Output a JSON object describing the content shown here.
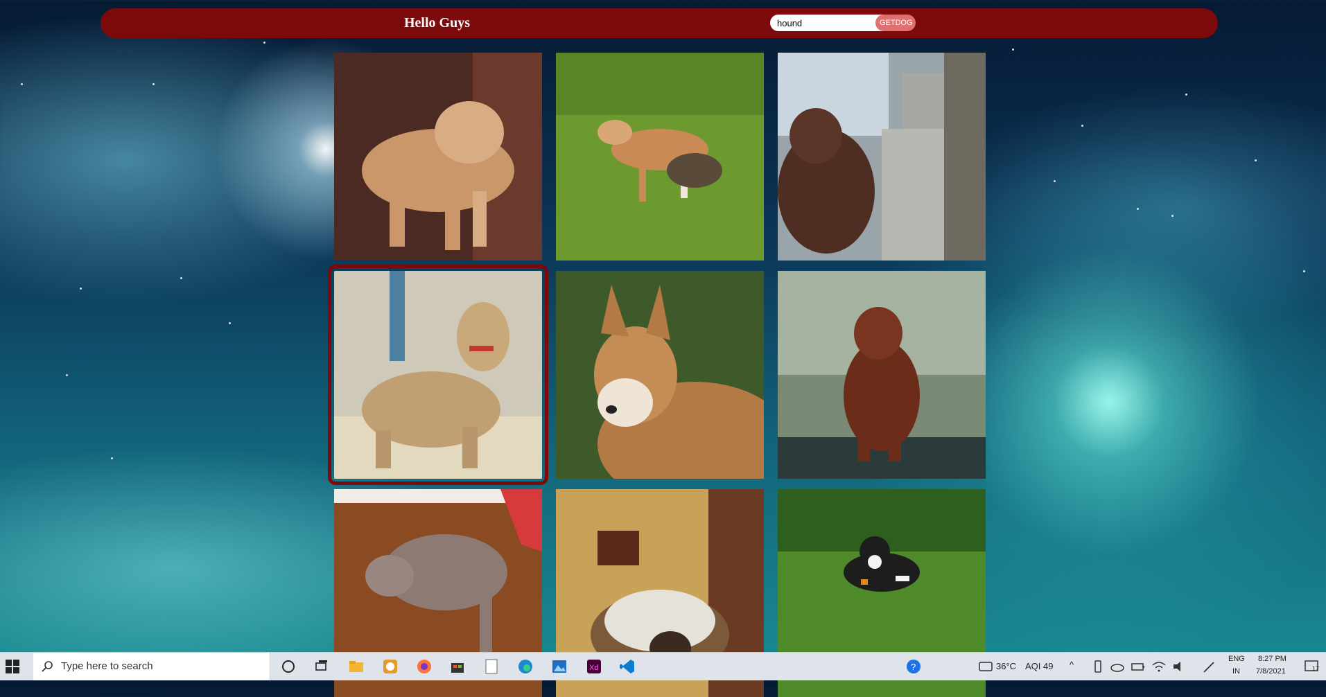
{
  "header": {
    "title": "Hello Guys",
    "search_value": "hound",
    "button_label": "GETDOG"
  },
  "dogs": [
    {
      "label": "dog photo 1"
    },
    {
      "label": "dog photo 2"
    },
    {
      "label": "dog photo 3"
    },
    {
      "label": "dog photo 4"
    },
    {
      "label": "dog photo 5"
    },
    {
      "label": "dog photo 6"
    },
    {
      "label": "dog photo 7"
    },
    {
      "label": "dog photo 8"
    },
    {
      "label": "dog photo 9"
    }
  ],
  "taskbar": {
    "search_placeholder": "Type here to search",
    "weather": "36°C",
    "aqi": "AQI 49",
    "lang_top": "ENG",
    "lang_bottom": "IN",
    "time": "8:27 PM",
    "date": "7/8/2021",
    "notification_count": "17",
    "pinned_icons": [
      "cortana-icon",
      "task-view-icon",
      "file-explorer-icon",
      "whatsapp-icon",
      "firefox-icon",
      "store-icon",
      "notepad-icon",
      "edge-icon",
      "photos-icon",
      "adobe-xd-icon",
      "vscode-icon"
    ]
  },
  "colors": {
    "nav": "#7d0a0a",
    "button": "#e07070",
    "selected_border": "#7d0a0a"
  }
}
